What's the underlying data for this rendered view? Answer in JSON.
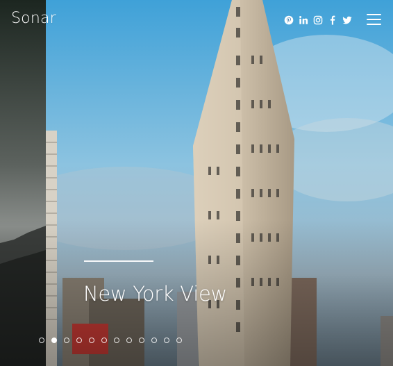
{
  "brand": {
    "name": "Sonar"
  },
  "header": {
    "social": [
      "pinterest-icon",
      "linkedin-icon",
      "instagram-icon",
      "facebook-icon",
      "twitter-icon"
    ],
    "menu_icon": "hamburger-icon"
  },
  "slider": {
    "title": "New York View",
    "slide_count": 12,
    "active_index": 1
  },
  "colors": {
    "sky_top": "#4aa8dc",
    "sky_bottom": "#9cb8c8",
    "building": "#c9bca8",
    "text": "#ffffff"
  }
}
